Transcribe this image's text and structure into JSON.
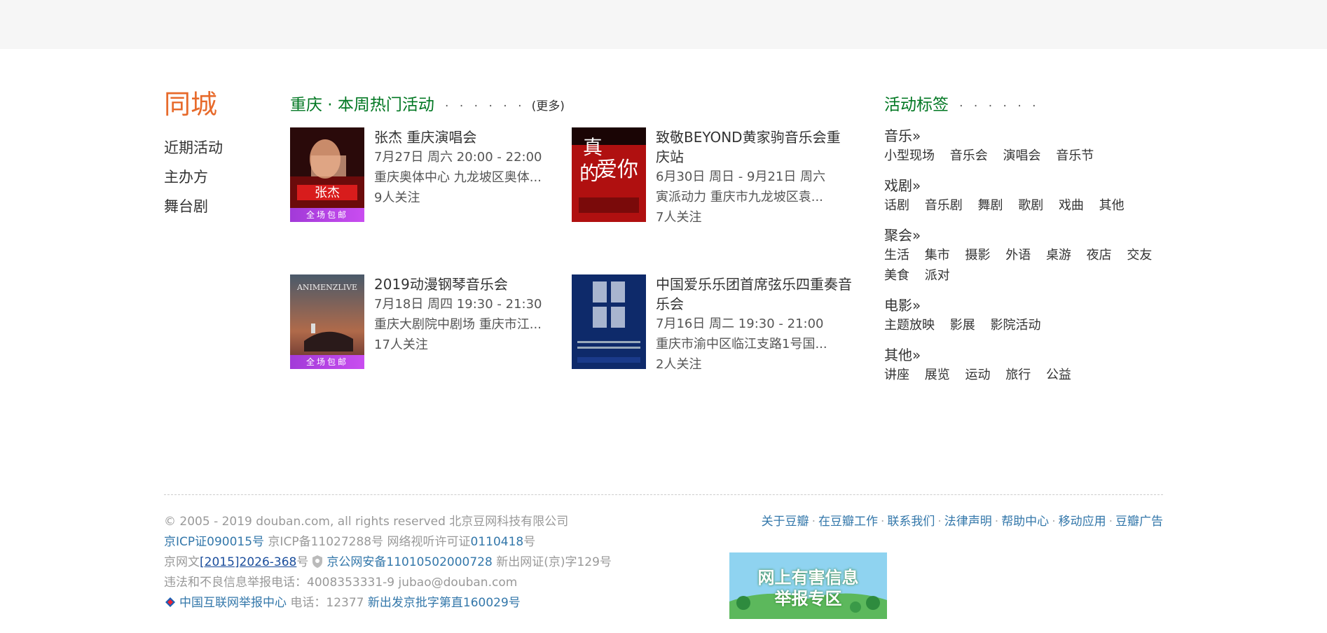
{
  "city": {
    "title": "同城",
    "nav": [
      "近期活动",
      "主办方",
      "舞台剧"
    ]
  },
  "hot_events": {
    "title": "重庆 · 本周热门活动",
    "dots": "· · · · · ·",
    "more_open": "(",
    "more": "更多",
    "more_close": ")",
    "items": [
      {
        "title": "张杰 重庆演唱会",
        "time": "7月27日 周六 20:00 - 22:00",
        "place": "重庆奥体中心 九龙坡区奥体...",
        "followers": "9人关注",
        "badge": "全场包邮"
      },
      {
        "title": "致敬BEYOND黄家驹音乐会重庆站",
        "time": "6月30日 周日 - 9月21日 周六",
        "place": "寅派动力 重庆市九龙坡区袁...",
        "followers": "7人关注"
      },
      {
        "title": "2019动漫钢琴音乐会",
        "time": "7月18日 周四 19:30 - 21:30",
        "place": "重庆大剧院中剧场 重庆市江...",
        "followers": "17人关注",
        "badge": "全场包邮"
      },
      {
        "title": "中国爱乐乐团首席弦乐四重奏音乐会",
        "time": "7月16日 周二 19:30 - 21:00",
        "place": "重庆市渝中区临江支路1号国...",
        "followers": "2人关注"
      }
    ]
  },
  "tags": {
    "title": "活动标签",
    "dots": "· · · · · ·",
    "groups": [
      {
        "name": "音乐»",
        "items": [
          "小型现场",
          "音乐会",
          "演唱会",
          "音乐节"
        ]
      },
      {
        "name": "戏剧»",
        "items": [
          "话剧",
          "音乐剧",
          "舞剧",
          "歌剧",
          "戏曲",
          "其他"
        ]
      },
      {
        "name": "聚会»",
        "items": [
          "生活",
          "集市",
          "摄影",
          "外语",
          "桌游",
          "夜店",
          "交友",
          "美食",
          "派对"
        ]
      },
      {
        "name": "电影»",
        "items": [
          "主题放映",
          "影展",
          "影院活动"
        ]
      },
      {
        "name": "其他»",
        "items": [
          "讲座",
          "展览",
          "运动",
          "旅行",
          "公益"
        ]
      }
    ]
  },
  "footer": {
    "copyright": "© 2005 - 2019 douban.com, all rights reserved 北京豆网科技有限公司",
    "icp1": "京ICP证090015号",
    "icp2": " 京ICP备11027288号 网络视听许可证",
    "license_no": "0110418",
    "hao": "号",
    "wen_prefix": "京网文",
    "wen_no": "[2015]2026-368",
    "wen_suffix": "号",
    "police": "京公网安备11010502000728",
    "xinchu": " 新出网证(京)字129号",
    "report_phone": "违法和不良信息举报电话：4008353331-9 ",
    "report_email": "jubao@douban.com",
    "center": "中国互联网举报中心",
    "center_phone": " 电话：12377 ",
    "xinchu2": "新出发京批字第直160029号",
    "links": [
      "关于豆瓣",
      "在豆瓣工作",
      "联系我们",
      "法律声明",
      "帮助中心",
      "移动应用",
      "豆瓣广告"
    ],
    "banner_line1": "网上有害信息",
    "banner_line2": "举报专区"
  }
}
